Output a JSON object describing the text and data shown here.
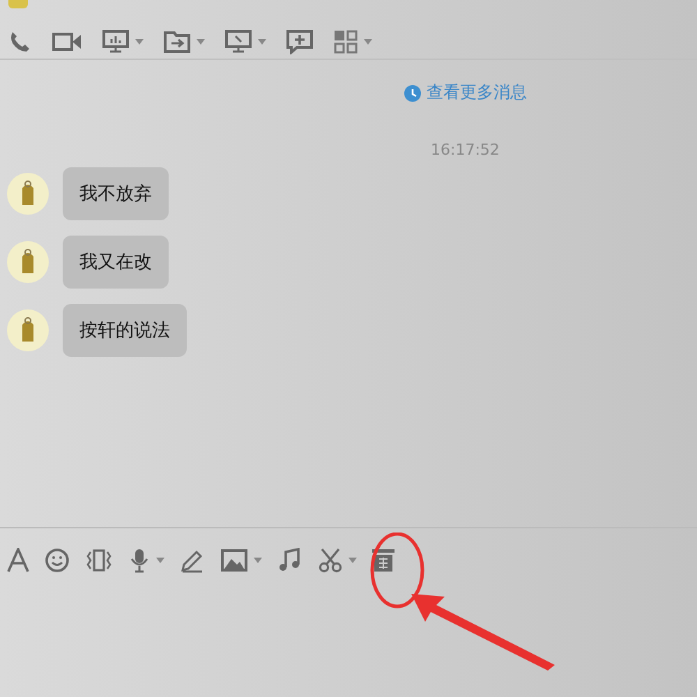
{
  "history_link": "查看更多消息",
  "timestamp": "16:17:52",
  "messages": [
    {
      "text": "我不放弃"
    },
    {
      "text": "我又在改"
    },
    {
      "text": "按轩的说法"
    }
  ]
}
